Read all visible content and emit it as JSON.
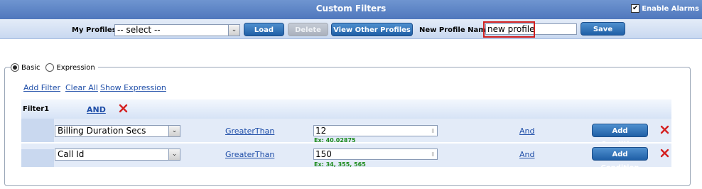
{
  "header": {
    "title": "Custom Filters",
    "enable_alarms_label": "Enable Alarms",
    "enable_alarms_checked": true
  },
  "toolbar": {
    "my_profiles_label": "My Profiles",
    "profile_select_value": "-- select --",
    "load_label": "Load",
    "delete_label": "Delete",
    "view_other_label": "View Other Profiles",
    "new_profile_label": "New Profile Name",
    "new_profile_value": "new profile",
    "save_label": "Save"
  },
  "mode": {
    "basic_label": "Basic",
    "expression_label": "Expression",
    "selected": "Basic"
  },
  "actions": {
    "add_filter": "Add Filter",
    "clear_all": "Clear All",
    "show_expression": "Show Expression"
  },
  "filter": {
    "name": "Filter1",
    "join": "AND",
    "conditions": [
      {
        "field": "Billing Duration Secs",
        "operator": "GreaterThan",
        "value": "12",
        "example": "Ex: 40.02875",
        "logic": "And",
        "add_label": "Add Condition"
      },
      {
        "field": "Call Id",
        "operator": "GreaterThan",
        "value": "150",
        "example": "Ex: 34, 355, 565",
        "logic": "And",
        "add_label": "Add Condition"
      }
    ]
  },
  "colors": {
    "header_bg": "#4f77bd",
    "button_bg": "#2f73bb",
    "delete_x": "#d42020",
    "example_text": "#1a8a1a",
    "highlight_border": "#d01f1f"
  }
}
